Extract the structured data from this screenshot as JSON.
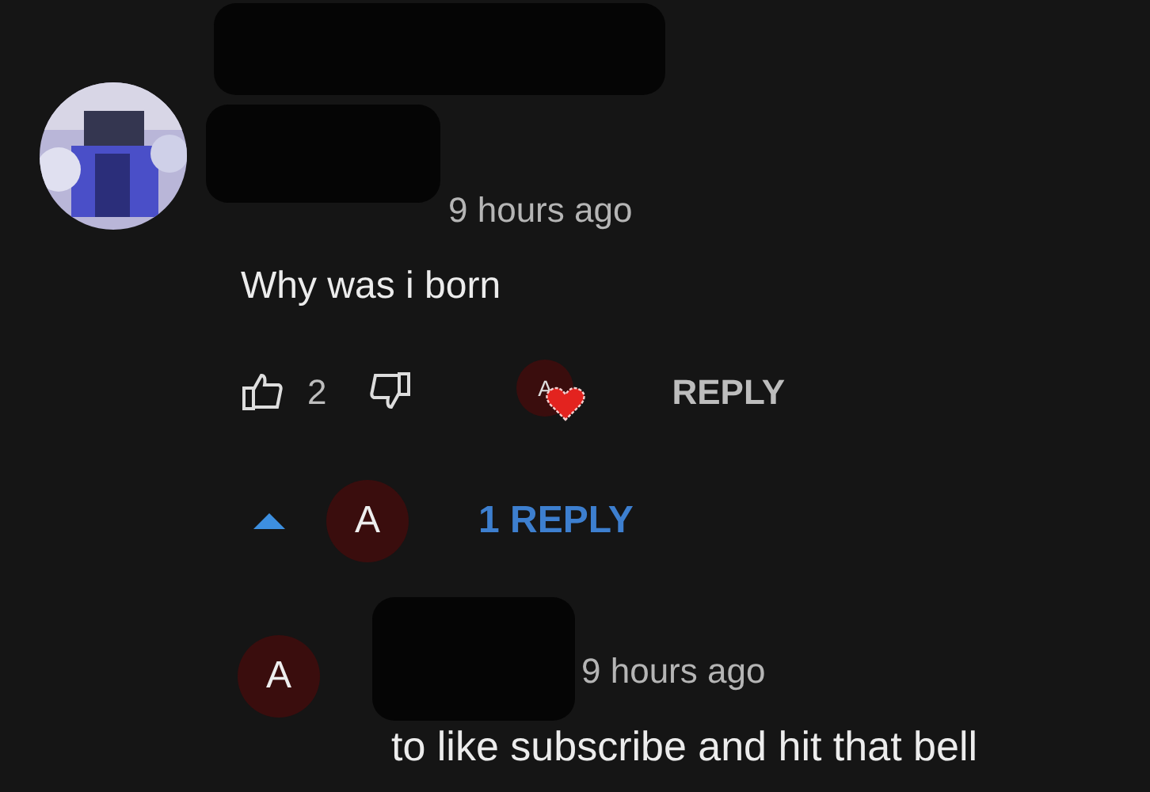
{
  "comment": {
    "time": "9 hours ago",
    "text": "Why was i born",
    "likes": "2",
    "hearted": true,
    "heart_avatar_letter": "A",
    "reply_button": "REPLY"
  },
  "replies_toggle": {
    "expanded": true,
    "avatar_letter": "A",
    "label": "1 REPLY"
  },
  "replies": [
    {
      "avatar_letter": "A",
      "time": "9 hours ago",
      "text": "to like subscribe and hit that bell"
    }
  ]
}
